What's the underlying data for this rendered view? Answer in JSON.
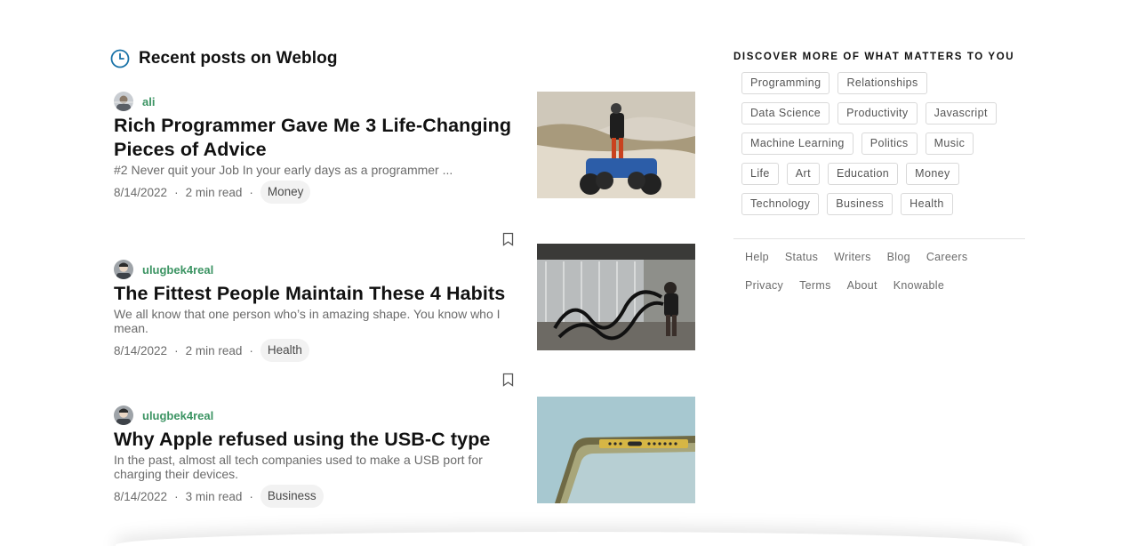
{
  "feed": {
    "title": "Recent posts on Weblog",
    "posts": [
      {
        "author": "ali",
        "title": "Rich Programmer Gave Me 3 Life-Changing Pieces of Advice",
        "snippet": "#2 Never quit your Job In your early days as a programmer ...",
        "date": "8/14/2022",
        "read_time": "2 min read",
        "tag": "Money",
        "thumbnail": "atv-rider-on-sand-dunes"
      },
      {
        "author": "ulugbek4real",
        "title": "The Fittest People Maintain These 4 Habits",
        "snippet": "We all know that one person who’s in amazing shape. You know who I mean.",
        "date": "8/14/2022",
        "read_time": "2 min read",
        "tag": "Health",
        "thumbnail": "battle-ropes-workout"
      },
      {
        "author": "ulugbek4real",
        "title": "Why Apple refused using the USB-C type",
        "snippet": "In the past, almost all tech companies used to make a USB port for charging their devices.",
        "date": "8/14/2022",
        "read_time": "3 min read",
        "tag": "Business",
        "thumbnail": "phone-lightning-port-closeup"
      }
    ],
    "separator": "·"
  },
  "sidebar": {
    "title": "DISCOVER MORE OF WHAT MATTERS TO YOU",
    "tags": [
      "Programming",
      "Relationships",
      "Data Science",
      "Productivity",
      "Javascript",
      "Machine Learning",
      "Politics",
      "Music",
      "Life",
      "Art",
      "Education",
      "Money",
      "Technology",
      "Business",
      "Health"
    ],
    "footer_links": [
      "Help",
      "Status",
      "Writers",
      "Blog",
      "Careers",
      "Privacy",
      "Terms",
      "About",
      "Knowable"
    ]
  },
  "colors": {
    "author_green": "#3c9463",
    "accent_blue": "#1a73a8"
  }
}
